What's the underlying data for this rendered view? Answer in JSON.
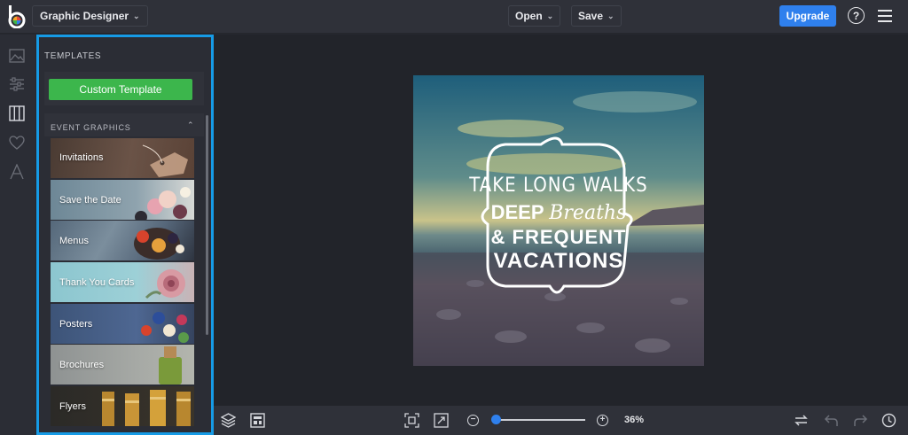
{
  "app": {
    "title": "Graphic Designer"
  },
  "toolbar": {
    "open_label": "Open",
    "save_label": "Save",
    "upgrade_label": "Upgrade",
    "help_label": "?"
  },
  "panel": {
    "title": "TEMPLATES",
    "custom_template_label": "Custom Template",
    "section_title": "EVENT GRAPHICS",
    "tiles": [
      {
        "label": "Invitations"
      },
      {
        "label": "Save the Date"
      },
      {
        "label": "Menus"
      },
      {
        "label": "Thank You Cards"
      },
      {
        "label": "Posters"
      },
      {
        "label": "Brochures"
      },
      {
        "label": "Flyers"
      }
    ]
  },
  "poster": {
    "line1": "TAKE LONG WALKS",
    "line2a": "DEEP",
    "line2b": "Breaths",
    "line3": "& FREQUENT",
    "line4": "VACATIONS"
  },
  "zoom": {
    "level": "36%",
    "fraction": 0.12
  },
  "colors": {
    "accent": "#2f80ed",
    "green_button": "#3cb64c",
    "panel_highlight": "#169be6"
  }
}
